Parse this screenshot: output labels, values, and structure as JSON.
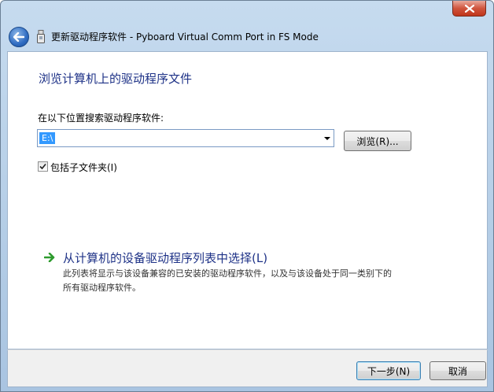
{
  "window": {
    "title": "更新驱动程序软件 - Pyboard Virtual Comm Port in FS Mode"
  },
  "page": {
    "heading": "浏览计算机上的驱动程序文件",
    "search_label": "在以下位置搜索驱动程序软件:",
    "path_value": "E:\\",
    "browse_label": "浏览(R)...",
    "include_subfolders_label": "包括子文件夹(I)",
    "include_subfolders_checked": true,
    "pick_link": "从计算机的设备驱动程序列表中选择(L)",
    "pick_desc_line1": "此列表将显示与该设备兼容的已安装的驱动程序软件，以及与该设备处于同一类别下的",
    "pick_desc_line2": "所有驱动程序软件。"
  },
  "footer": {
    "next_label": "下一步(N)",
    "cancel_label": "取消"
  },
  "icons": {
    "close": "close-icon",
    "back": "back-arrow-icon",
    "device": "usb-device-icon",
    "link_arrow": "green-arrow-icon",
    "checkbox": "checkmark-icon",
    "dropdown": "chevron-down-icon"
  },
  "colors": {
    "heading": "#1e3287",
    "selection": "#3399ff",
    "close_button": "#c7402a",
    "link_arrow": "#2e9b2e"
  }
}
